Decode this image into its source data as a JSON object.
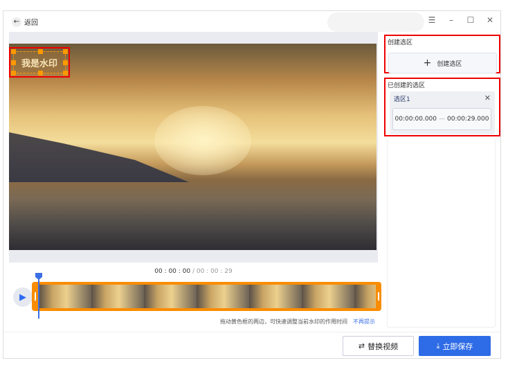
{
  "titlebar": {
    "back_label": "返回",
    "window_buttons": {
      "menu": "☰",
      "minimize": "–",
      "maximize": "☐",
      "close": "✕"
    }
  },
  "video": {
    "watermark_text": "我是水印"
  },
  "timeline": {
    "current": "00 : 00 : 00",
    "separator": " / ",
    "total": "00 : 00 : 29",
    "hint": "拖动黄色框的两边，可快速调整当前水印的作用时间",
    "dismiss": "不再提示"
  },
  "right": {
    "create_section_label": "创建选区",
    "create_button": "创建选区",
    "created_section_label": "已创建的选区",
    "selections": [
      {
        "name": "选区1",
        "start": "00:00:00.000",
        "end": "00:00:29.000"
      }
    ]
  },
  "footer": {
    "replace_video": "替换视频",
    "save_now": "立即保存"
  },
  "colors": {
    "accent": "#2e6be6",
    "track": "#f98c00",
    "highlight": "#e00000"
  }
}
